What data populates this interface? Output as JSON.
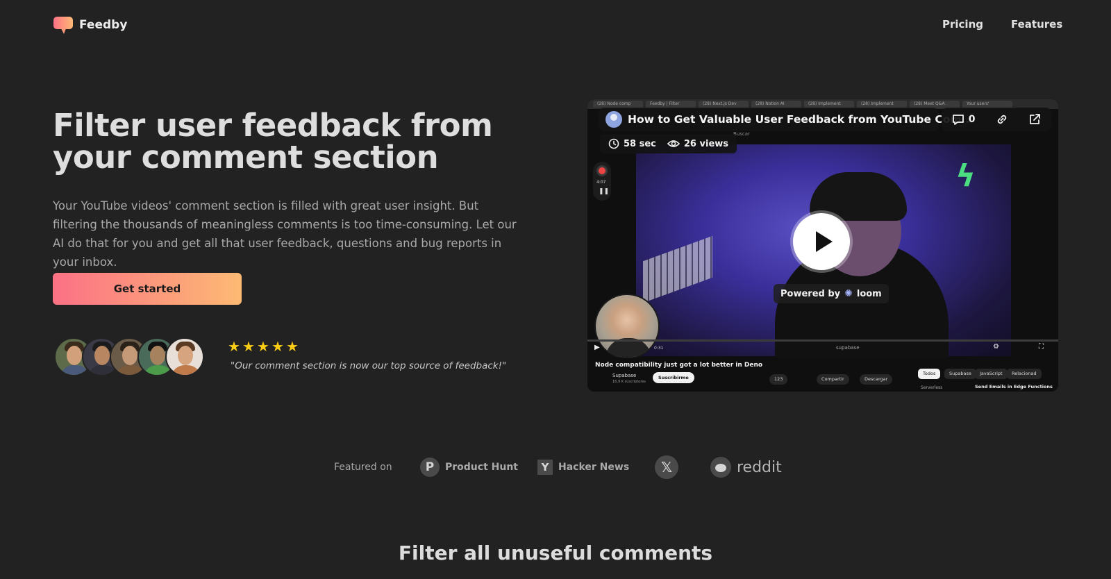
{
  "nav": {
    "brand": "Feedby",
    "links": [
      "Pricing",
      "Features"
    ]
  },
  "hero": {
    "title": "Filter user feedback from your comment section",
    "description": "Your YouTube videos' comment section is filled with great user insight. But filtering the thousands of meaningless comments is too time-consuming. Let our AI do that for you and get all that user feedback, questions and bug reports in your inbox.",
    "cta": "Get started",
    "rating": 5,
    "quote": "\"Our comment section is now our top source of feedback!\""
  },
  "video": {
    "title": "How to Get Valuable User Feedback from YouTube Com...",
    "comments_count": "0",
    "duration": "58 sec",
    "views": "26 views",
    "powered_by": "Powered by",
    "provider": "loom",
    "browser_tabs": [
      "(28) Node comp",
      "Feedby | Filter",
      "(28) Next.js Dev",
      "(28) Notion AI",
      "(28) Implement",
      "(28) Implement",
      "(28) Meet Q&A",
      "Your users'"
    ],
    "rec_time": "4:07",
    "yt_search_placeholder": "Buscar",
    "yt_video_title": "Node compatibility just got a lot better in Deno",
    "yt_channel": "Supabase",
    "yt_subscribers": "16,9 K suscriptores",
    "yt_subscribe": "Suscribirme",
    "yt_likes": "123",
    "yt_share": "Compartir",
    "yt_download": "Descargar",
    "yt_chips": [
      "Todos",
      "Supabase",
      "JavaScript",
      "Relacionad"
    ],
    "yt_next": "Send Emails in Edge Functions",
    "yt_next_channel": "Serverless",
    "yt_player_time": "0:31",
    "yt_watermark": "supabase"
  },
  "featured": {
    "label": "Featured on",
    "items": [
      {
        "name": "Product Hunt",
        "mark": "P"
      },
      {
        "name": "Hacker News",
        "mark": "Y"
      },
      {
        "name": "",
        "mark": "𝕏"
      },
      {
        "name": "reddit",
        "mark": ""
      }
    ]
  },
  "section": {
    "title": "Filter all unuseful comments"
  },
  "colors": {
    "background": "#222222",
    "cta_start": "#fb7185",
    "cta_end": "#fdba74",
    "star": "#facc15"
  }
}
